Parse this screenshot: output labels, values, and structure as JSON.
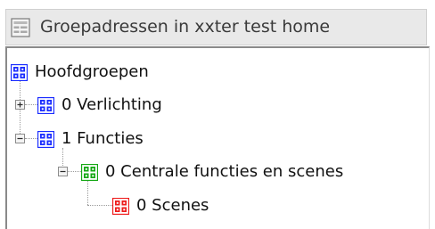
{
  "window": {
    "title": "Groepadressen in xxter test home",
    "title_icon": "tree-table-icon"
  },
  "tree": {
    "items": [
      {
        "label": "Hoofdgroepen",
        "level": 0,
        "icon": "group-blue-icon",
        "color": "#1a2cff",
        "expander": "none"
      },
      {
        "label": "0 Verlichting",
        "level": 1,
        "icon": "group-blue-icon",
        "color": "#1a2cff",
        "expander": "collapsed"
      },
      {
        "label": "1 Functies",
        "level": 1,
        "icon": "group-blue-icon",
        "color": "#1a2cff",
        "expander": "expanded"
      },
      {
        "label": "0 Centrale functies en scenes",
        "level": 2,
        "icon": "group-green-icon",
        "color": "#15a815",
        "expander": "expanded"
      },
      {
        "label": "0 Scenes",
        "level": 3,
        "icon": "group-red-icon",
        "color": "#ee1c1c",
        "expander": "none"
      }
    ]
  },
  "colors": {
    "header_bg": "#e9e9e9",
    "tree_border": "#8a8a8a",
    "text": "#111111"
  }
}
